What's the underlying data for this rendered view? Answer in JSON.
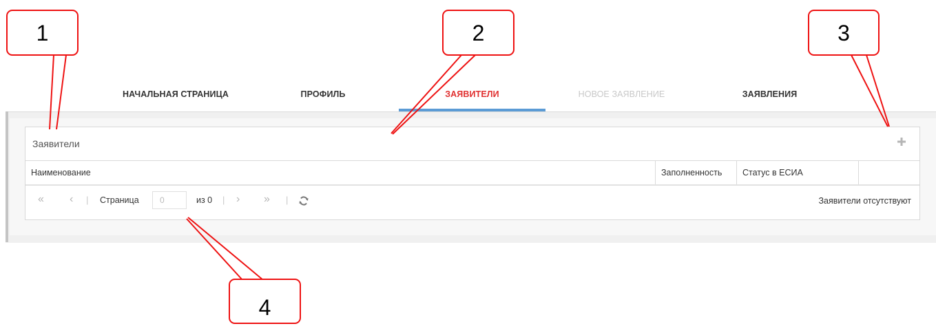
{
  "nav": {
    "tabs": [
      {
        "label": "НАЧАЛЬНАЯ СТРАНИЦА",
        "state": "normal"
      },
      {
        "label": "ПРОФИЛЬ",
        "state": "normal"
      },
      {
        "label": "ЗАЯВИТЕЛИ",
        "state": "active"
      },
      {
        "label": "НОВОЕ ЗАЯВЛЕНИЕ",
        "state": "disabled"
      },
      {
        "label": "ЗАЯВЛЕНИЯ",
        "state": "normal"
      }
    ],
    "active_color": "#e03030",
    "underline_color": "#5b9bd5"
  },
  "panel": {
    "title": "Заявители",
    "add_icon": "plus-icon"
  },
  "table": {
    "columns": [
      "Наименование",
      "Заполненность",
      "Статус в ЕСИА",
      ""
    ]
  },
  "pager": {
    "first_icon": "«",
    "prev_icon": "‹",
    "next_icon": "›",
    "last_icon": "»",
    "page_label": "Страница",
    "page_value": "0",
    "of_label": "из 0",
    "refresh_icon": "refresh-icon",
    "status": "Заявители отсутствуют"
  },
  "callouts": {
    "color": "#ee1111",
    "labels": [
      "1",
      "2",
      "3",
      "4"
    ]
  }
}
